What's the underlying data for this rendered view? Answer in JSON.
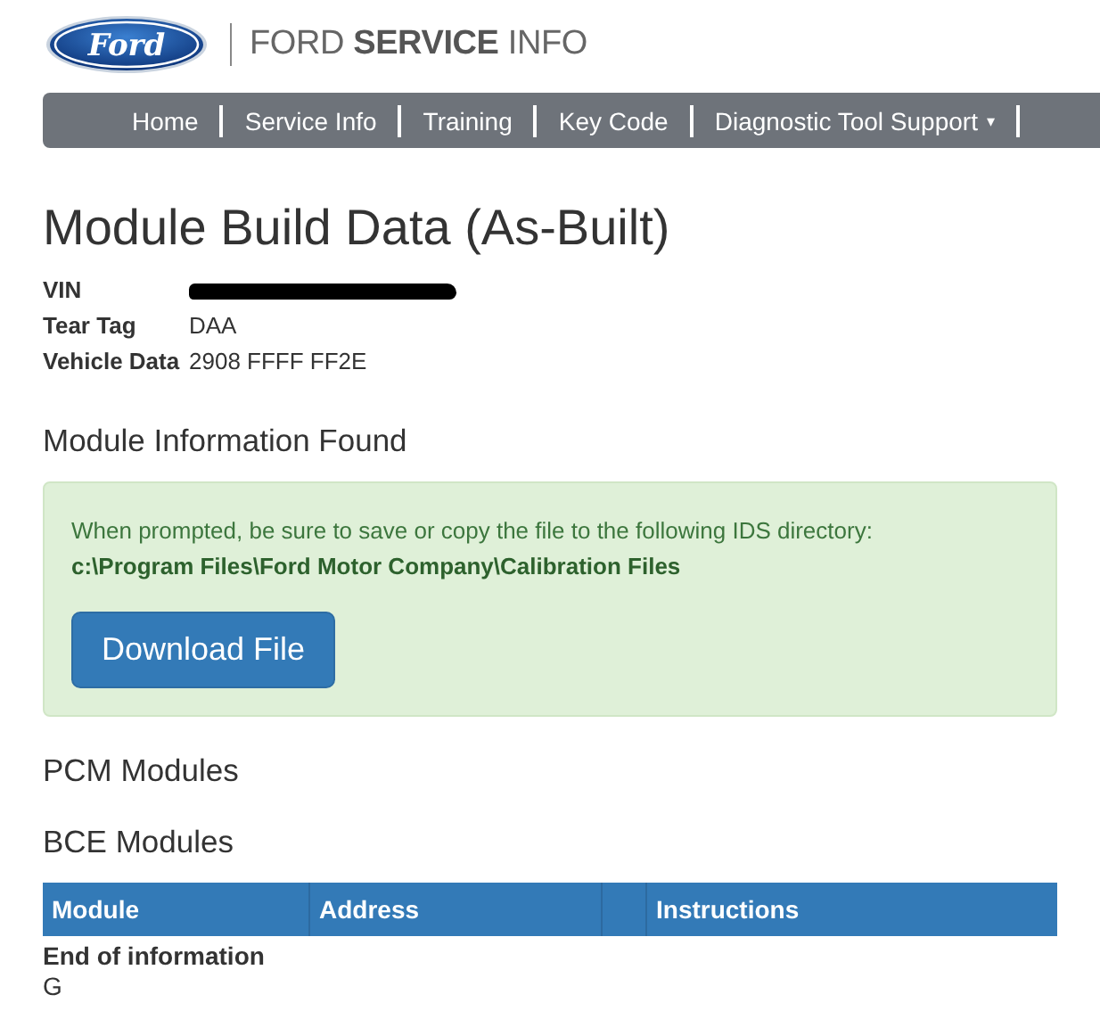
{
  "header": {
    "logo_text": "Ford",
    "brand_light_1": "FORD ",
    "brand_bold": "SERVICE",
    "brand_light_2": " INFO"
  },
  "nav": {
    "items": [
      {
        "label": "Home",
        "dropdown": false
      },
      {
        "label": "Service Info",
        "dropdown": false
      },
      {
        "label": "Training",
        "dropdown": false
      },
      {
        "label": "Key Code",
        "dropdown": false
      },
      {
        "label": "Diagnostic Tool Support",
        "dropdown": true
      }
    ],
    "caret": "▾"
  },
  "title": "Module Build Data (As-Built)",
  "vehicle": [
    {
      "label": "VIN",
      "redacted": true
    },
    {
      "label": "Tear Tag",
      "value": "DAA",
      "redacted": false
    },
    {
      "label": "Vehicle Data",
      "value": "2908 FFFF FF2E",
      "redacted": false
    }
  ],
  "found_heading": "Module Information Found",
  "alert": {
    "text": "When prompted, be sure to save or copy the file to the following IDS directory:",
    "path": "c:\\Program Files\\Ford Motor Company\\Calibration Files",
    "button": "Download File"
  },
  "sections": [
    "PCM Modules",
    "BCE Modules"
  ],
  "table": {
    "columns": [
      "Module",
      "Address",
      "",
      "Instructions"
    ]
  },
  "end_text": "End of information",
  "footer_text": "G"
}
